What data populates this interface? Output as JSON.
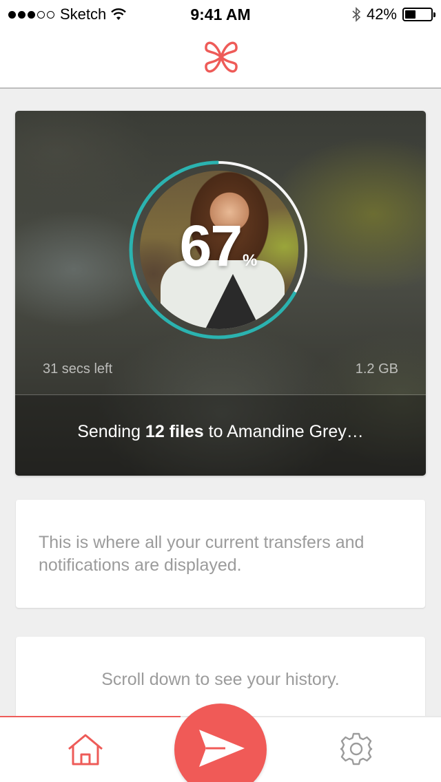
{
  "status_bar": {
    "carrier": "Sketch",
    "time": "9:41 AM",
    "battery_percent": "42%",
    "battery_level": 0.42,
    "signal_bars_filled": 3,
    "signal_bars_total": 5,
    "icons": [
      "signal-dots-icon",
      "wifi-icon",
      "bluetooth-icon",
      "battery-icon"
    ]
  },
  "nav": {
    "logo_icon": "clover-logo-icon",
    "logo_color": "#ee5b58"
  },
  "transfer": {
    "progress": 0.67,
    "percent_number": "67",
    "percent_sign": "%",
    "time_left": "31 secs left",
    "size": "1.2 GB",
    "sending_prefix": "Sending ",
    "sending_count": "12 files",
    "sending_suffix": " to Amandine Grey…",
    "ring_color": "#2bb3b0",
    "ring_track_color": "#ffffff"
  },
  "info_card": {
    "text": "This is where all your current transfers and notifications are displayed."
  },
  "history_card": {
    "text": "Scroll down to see your history."
  },
  "tab_bar": {
    "home_icon": "home-icon",
    "send_icon": "send-paper-plane-icon",
    "settings_icon": "gear-icon",
    "accent_color": "#ee5b58"
  }
}
